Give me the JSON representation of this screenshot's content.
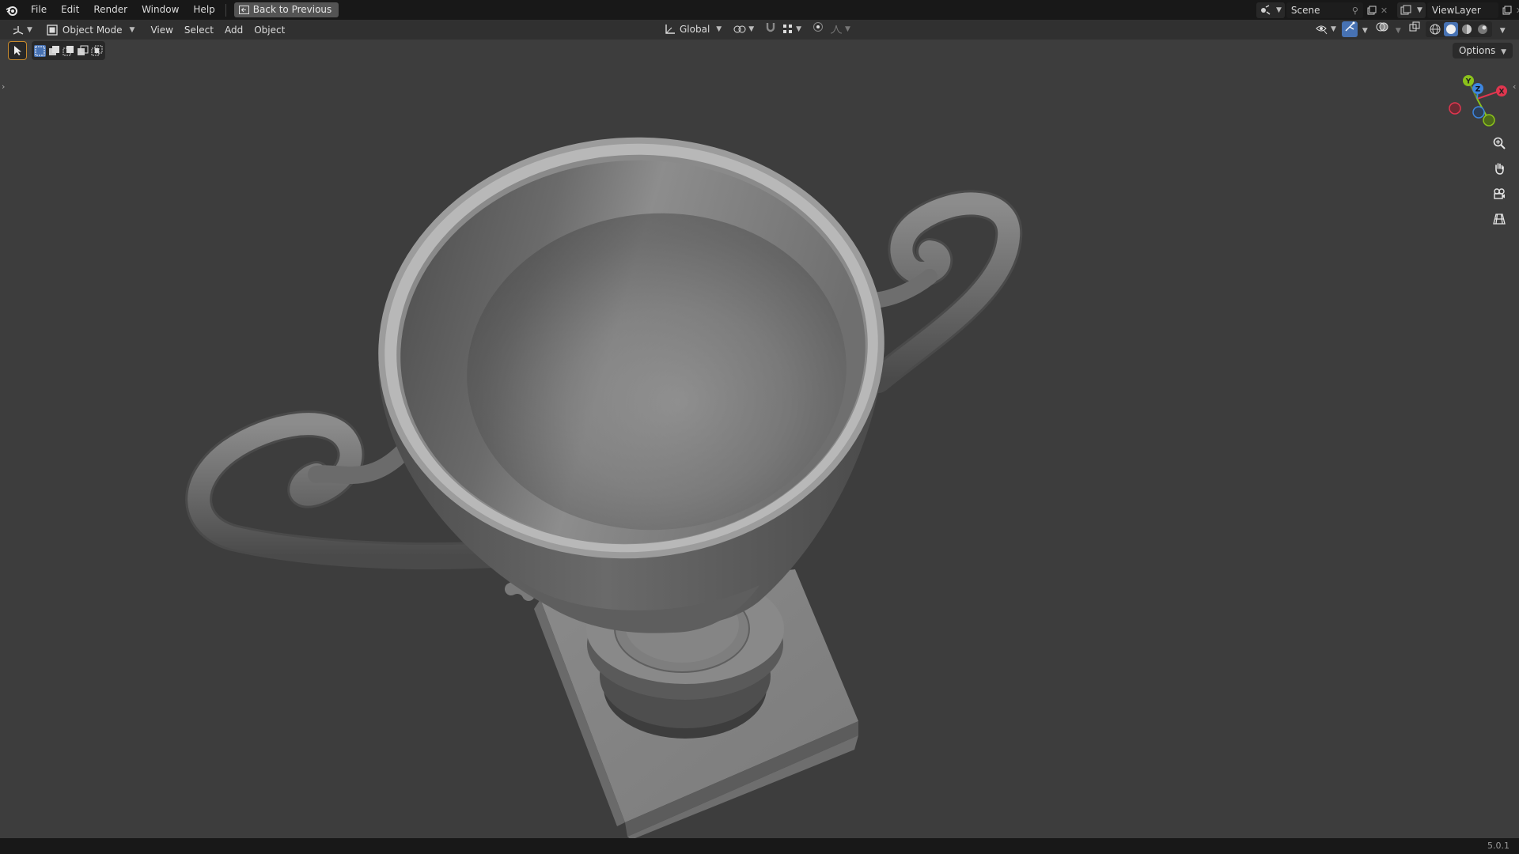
{
  "menus": [
    "File",
    "Edit",
    "Render",
    "Window",
    "Help"
  ],
  "back_button": "Back to Previous",
  "scene_name": "Scene",
  "view_layer": "ViewLayer",
  "mode": "Object Mode",
  "header_menus": [
    "View",
    "Select",
    "Add",
    "Object"
  ],
  "orientation": "Global",
  "options_label": "Options",
  "gizmo": {
    "x": "X",
    "y": "Y",
    "z": "Z"
  },
  "version": "5.0.1",
  "colors": {
    "accent": "#4772b3",
    "viewport_bg": "#3d3d3d",
    "x_axis": "#e1364f",
    "y_axis": "#8bc21b",
    "z_axis": "#3d86e0"
  }
}
